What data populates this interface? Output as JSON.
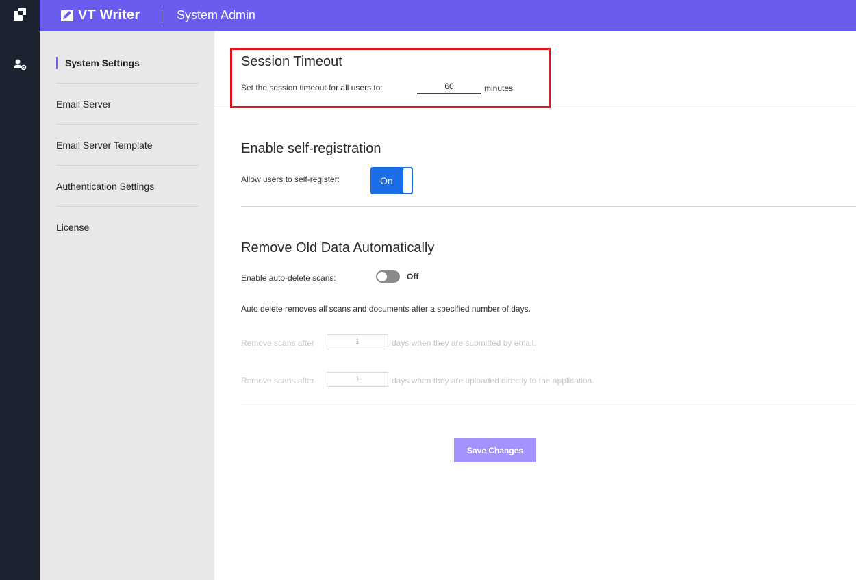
{
  "rail": {
    "logo_icon": "app-logo-icon",
    "user_icon": "user-settings-icon"
  },
  "header": {
    "brand": "VT Writer",
    "section": "System Admin",
    "brand_color": "#6b5cf0"
  },
  "sidebar": {
    "items": [
      {
        "label": "System Settings",
        "active": true
      },
      {
        "label": "Email Server"
      },
      {
        "label": "Email Server Template"
      },
      {
        "label": "Authentication Settings"
      },
      {
        "label": "License"
      }
    ]
  },
  "session_timeout": {
    "title": "Session Timeout",
    "prompt": "Set the session timeout for all users to:",
    "value": "60",
    "unit": "minutes"
  },
  "self_registration": {
    "title": "Enable self-registration",
    "prompt": "Allow users to self-register:",
    "toggle_label": "On"
  },
  "remove_old_data": {
    "title": "Remove Old Data Automatically",
    "auto_delete_prompt": "Enable auto-delete scans:",
    "toggle_label": "Off",
    "description": "Auto delete removes all scans and documents after a specified number of days.",
    "email_row": {
      "prefix": "Remove scans after",
      "value": "1",
      "suffix": "days when they are submitted by email."
    },
    "upload_row": {
      "prefix": "Remove scans after",
      "value": "1",
      "suffix": "days when they are uploaded directly to the application."
    }
  },
  "actions": {
    "save_label": "Save Changes"
  }
}
